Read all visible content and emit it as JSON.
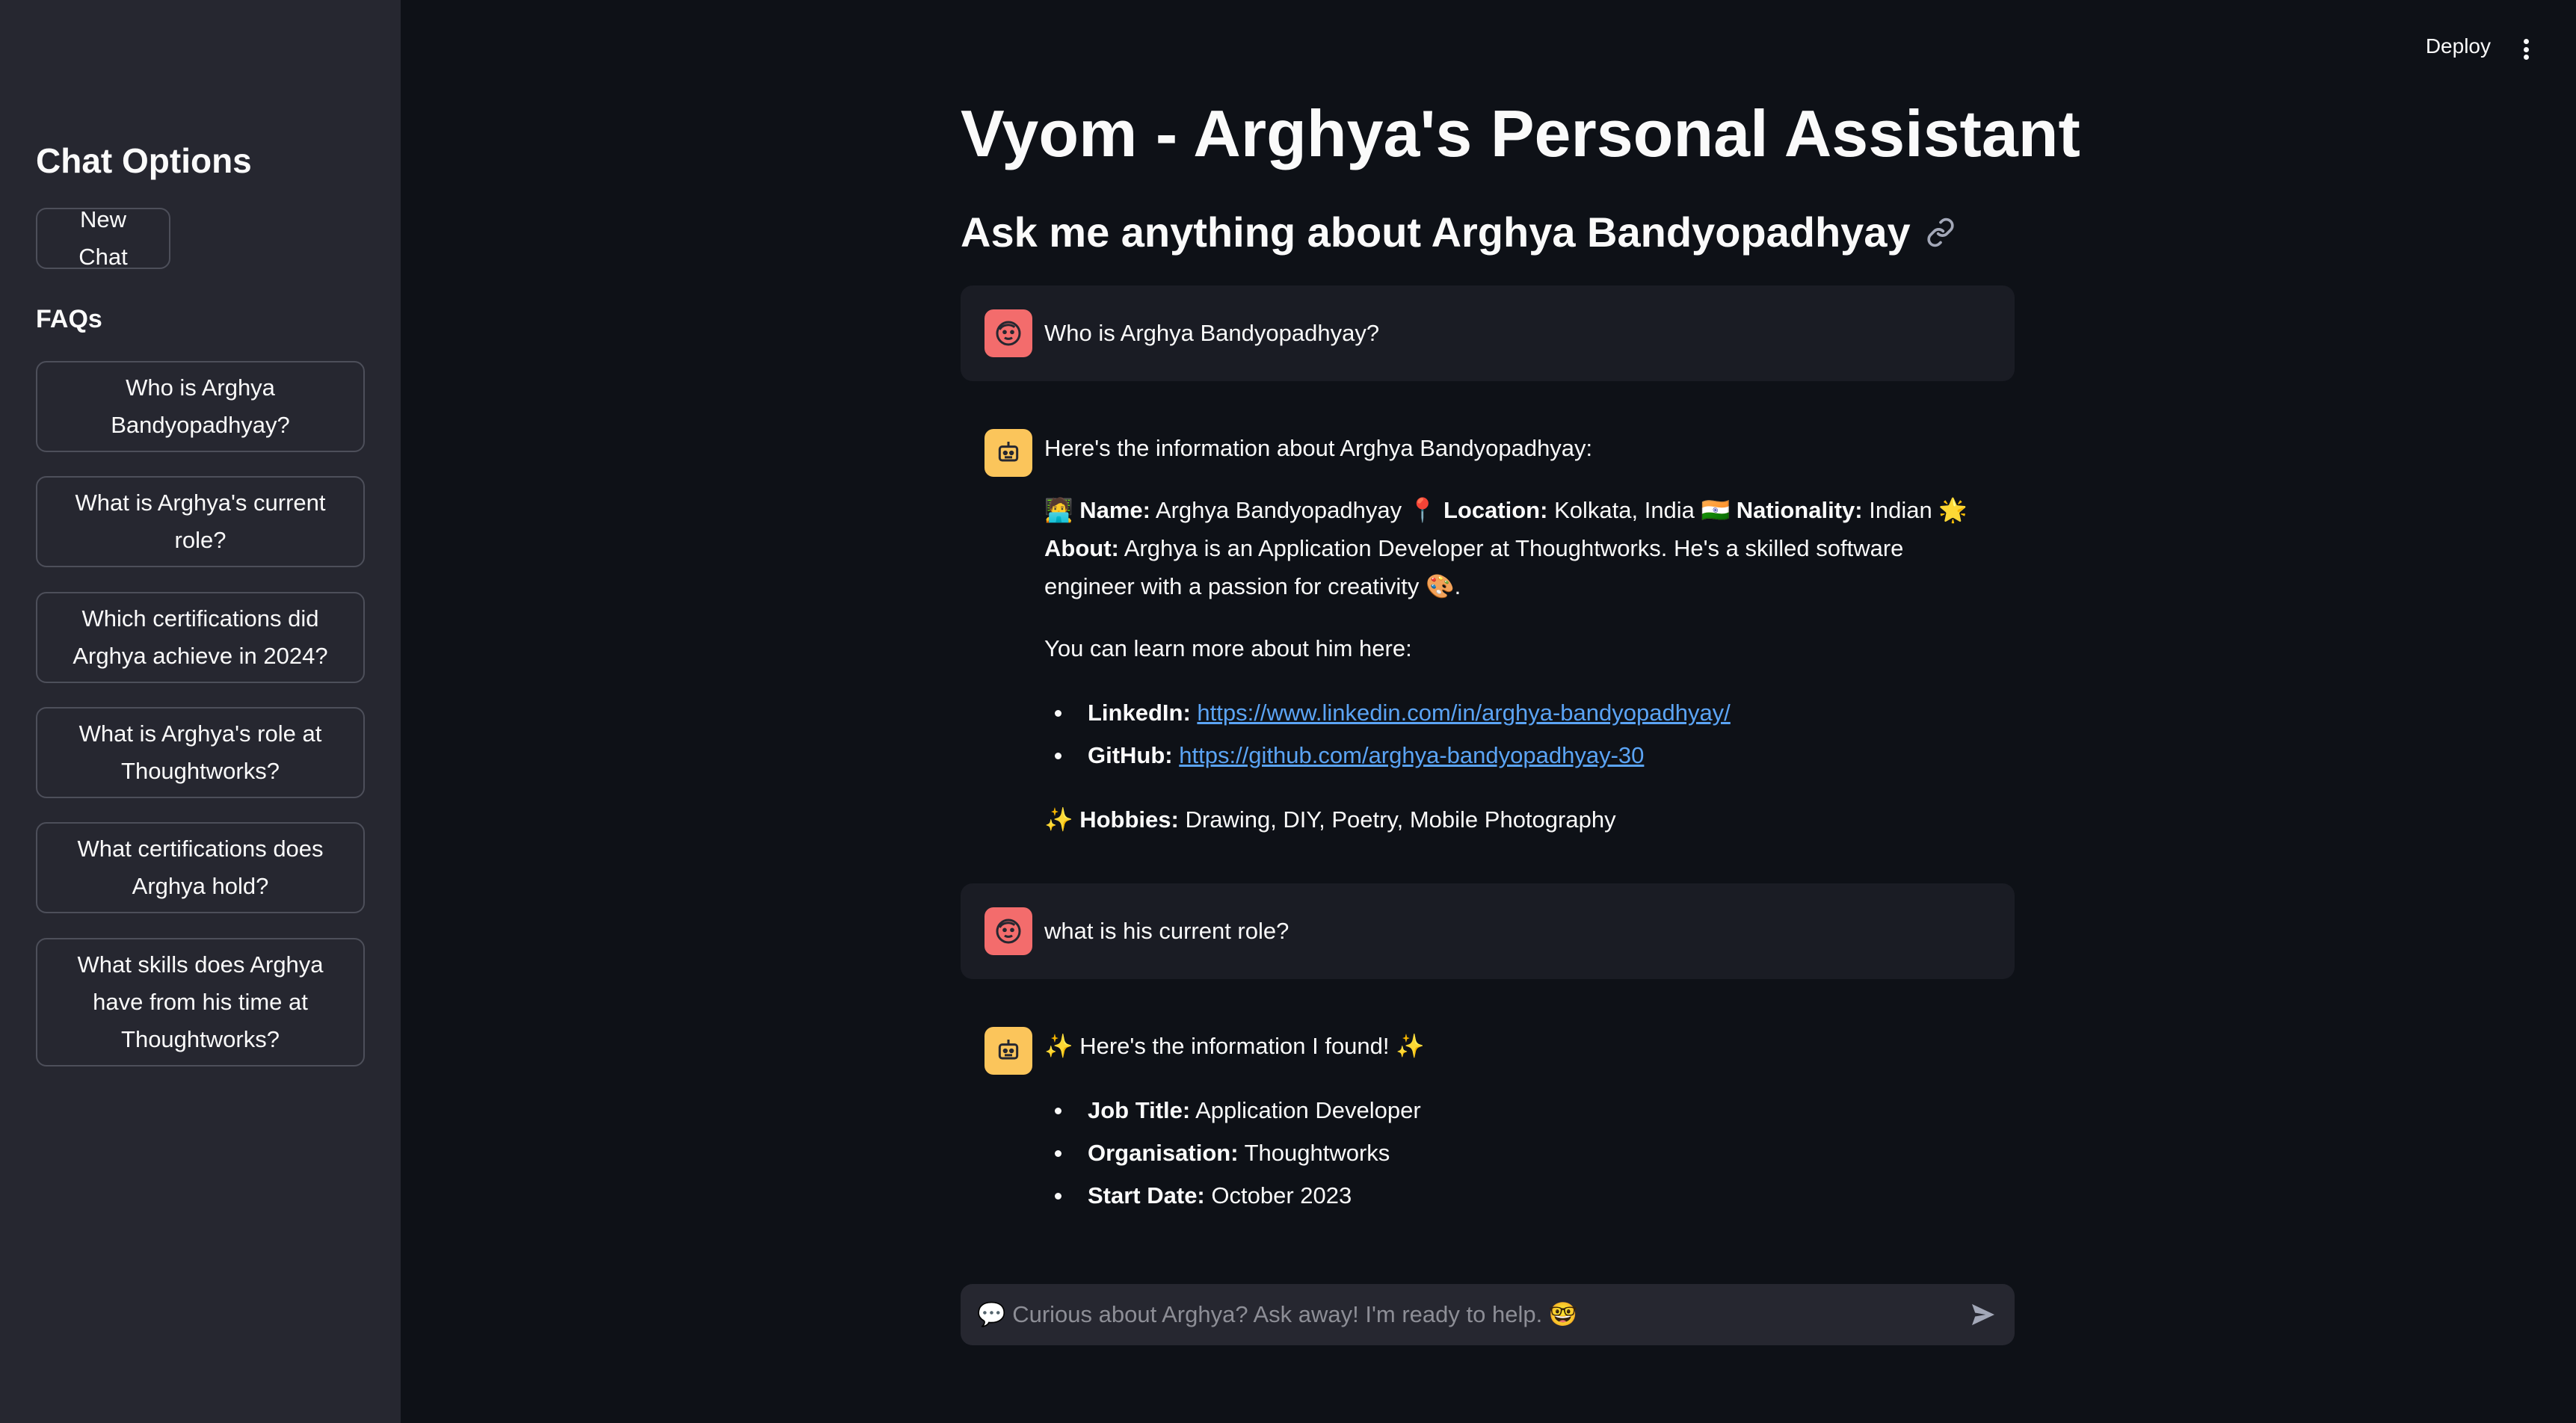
{
  "sidebar": {
    "title": "Chat Options",
    "new_chat_label": "New Chat",
    "faqs_title": "FAQs",
    "faqs": [
      "Who is Arghya Bandyopadhyay?",
      "What is Arghya's current role?",
      "Which certifications did Arghya achieve in 2024?",
      "What is Arghya's role at Thoughtworks?",
      "What certifications does Arghya hold?",
      "What skills does Arghya have from his time at Thoughtworks?"
    ]
  },
  "topbar": {
    "deploy_label": "Deploy",
    "menu_icon": "vertical-ellipsis-icon"
  },
  "main": {
    "title": "Vyom - Arghya's Personal Assistant",
    "subtitle": "Ask me anything about Arghya Bandyopadhyay",
    "subtitle_icon": "link-icon"
  },
  "messages": {
    "q1": "Who is Arghya Bandyopadhyay?",
    "a1": {
      "intro": "Here's the information about Arghya Bandyopadhyay:",
      "name_emoji": "🧑‍💻",
      "name_label": "Name:",
      "name_value": "Arghya Bandyopadhyay",
      "location_emoji": "📍",
      "location_label": "Location:",
      "location_value": "Kolkata, India",
      "flag_emoji": "🇮🇳",
      "nationality_label": "Nationality:",
      "nationality_value": "Indian",
      "about_emoji": "🌟",
      "about_label": "About:",
      "about_value": "Arghya is an Application Developer at Thoughtworks. He's a skilled software engineer with a passion for creativity",
      "about_end_emoji": "🎨",
      "about_end": ".",
      "learn_more": "You can learn more about him here:",
      "linkedin_label": "LinkedIn:",
      "linkedin_url": "https://www.linkedin.com/in/arghya-bandyopadhyay/",
      "github_label": "GitHub:",
      "github_url": "https://github.com/arghya-bandyopadhyay-30",
      "hobbies_emoji": "✨",
      "hobbies_label": "Hobbies:",
      "hobbies_value": "Drawing, DIY, Poetry, Mobile Photography"
    },
    "q2": "what is his current role?",
    "a2": {
      "intro": "✨ Here's the information I found! ✨",
      "job_title_label": "Job Title:",
      "job_title_value": "Application Developer",
      "organisation_label": "Organisation:",
      "organisation_value": "Thoughtworks",
      "start_date_label": "Start Date:",
      "start_date_value": "October 2023"
    }
  },
  "input": {
    "placeholder": "💬 Curious about Arghya? Ask away! I'm ready to help. 🤓",
    "send_icon": "send-icon"
  },
  "colors": {
    "background": "#0e1117",
    "sidebar": "#262730",
    "user_avatar": "#f36c6c",
    "bot_avatar": "#fbc55b",
    "link": "#5ba4f5"
  }
}
